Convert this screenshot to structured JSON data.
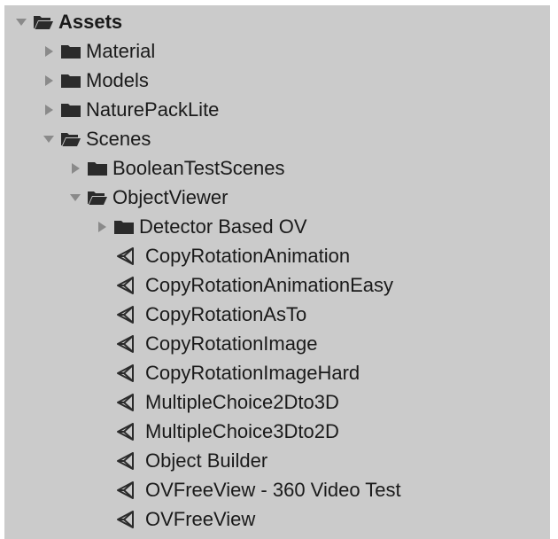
{
  "tree": {
    "root": {
      "label": "Assets",
      "expanded": true
    },
    "items": [
      {
        "label": "Material",
        "kind": "folder",
        "expanded": false
      },
      {
        "label": "Models",
        "kind": "folder",
        "expanded": false
      },
      {
        "label": "NaturePackLite",
        "kind": "folder",
        "expanded": false
      },
      {
        "label": "Scenes",
        "kind": "folder",
        "expanded": true
      },
      {
        "label": "BooleanTestScenes",
        "kind": "folder",
        "expanded": false
      },
      {
        "label": "ObjectViewer",
        "kind": "folder",
        "expanded": true
      },
      {
        "label": "Detector Based OV",
        "kind": "folder",
        "expanded": false
      },
      {
        "label": "CopyRotationAnimation",
        "kind": "scene"
      },
      {
        "label": "CopyRotationAnimationEasy",
        "kind": "scene"
      },
      {
        "label": "CopyRotationAsTo",
        "kind": "scene"
      },
      {
        "label": "CopyRotationImage",
        "kind": "scene"
      },
      {
        "label": "CopyRotationImageHard",
        "kind": "scene"
      },
      {
        "label": "MultipleChoice2Dto3D",
        "kind": "scene"
      },
      {
        "label": "MultipleChoice3Dto2D",
        "kind": "scene"
      },
      {
        "label": "Object Builder",
        "kind": "scene"
      },
      {
        "label": "OVFreeView - 360 Video Test",
        "kind": "scene"
      },
      {
        "label": "OVFreeView",
        "kind": "scene"
      }
    ]
  },
  "colors": {
    "panel_background": "#cbcbcb",
    "text": "#1a1a1a",
    "folder_icon": "#2b2b2b",
    "arrow": "#8a8a8a"
  },
  "icons": {
    "expanded_arrow": "triangle-down-icon",
    "collapsed_arrow": "triangle-right-icon",
    "closed_folder": "folder-icon",
    "open_folder": "folder-open-icon",
    "scene_file": "unity-scene-icon"
  }
}
